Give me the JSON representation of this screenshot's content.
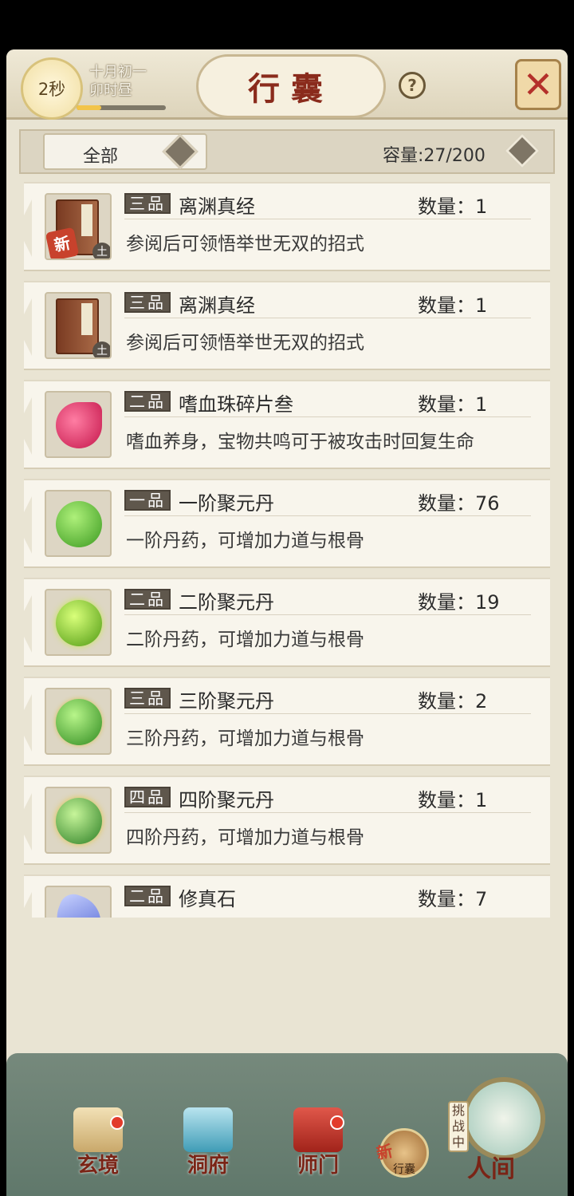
{
  "header": {
    "timer": "2秒",
    "date_line1": "十月初一",
    "date_line2": "卯时昼",
    "title": "行囊",
    "help": "?",
    "close": "✕"
  },
  "filter": {
    "selected": "全部",
    "capacity": "容量:27/200"
  },
  "items": [
    {
      "grade": "三品",
      "name": "离渊真经",
      "qty": "数量：1",
      "desc": "参阅后可领悟举世无双的招式",
      "new": "新",
      "element": "土",
      "icon": "book-icon"
    },
    {
      "grade": "三品",
      "name": "离渊真经",
      "qty": "数量：1",
      "desc": "参阅后可领悟举世无双的招式",
      "element": "土",
      "icon": "book-icon"
    },
    {
      "grade": "二品",
      "name": "嗜血珠碎片叁",
      "qty": "数量：1",
      "desc": "嗜血养身，宝物共鸣可于被攻击时回复生命",
      "icon": "blood-shard-icon"
    },
    {
      "grade": "一品",
      "name": "一阶聚元丹",
      "qty": "数量：76",
      "desc": "一阶丹药，可增加力道与根骨",
      "icon": "pill-icon"
    },
    {
      "grade": "二品",
      "name": "二阶聚元丹",
      "qty": "数量：19",
      "desc": "二阶丹药，可增加力道与根骨",
      "icon": "pill-icon"
    },
    {
      "grade": "三品",
      "name": "三阶聚元丹",
      "qty": "数量：2",
      "desc": "三阶丹药，可增加力道与根骨",
      "icon": "pill-icon"
    },
    {
      "grade": "四品",
      "name": "四阶聚元丹",
      "qty": "数量：1",
      "desc": "四阶丹药，可增加力道与根骨",
      "icon": "pill-icon"
    },
    {
      "grade": "二品",
      "name": "修真石",
      "qty": "数量：7",
      "desc": "",
      "icon": "crystal-icon"
    }
  ],
  "nav": {
    "xuanjing": "玄境",
    "dongfu": "洞府",
    "shimen": "师门",
    "xingnang": "行囊",
    "xingnang_new": "新",
    "challenge": "挑战中",
    "renjian": "人间"
  },
  "colors": {
    "grade_bg": "#5f574c",
    "title_red": "#8a2b1c",
    "bottom_green": "#6a8275"
  }
}
